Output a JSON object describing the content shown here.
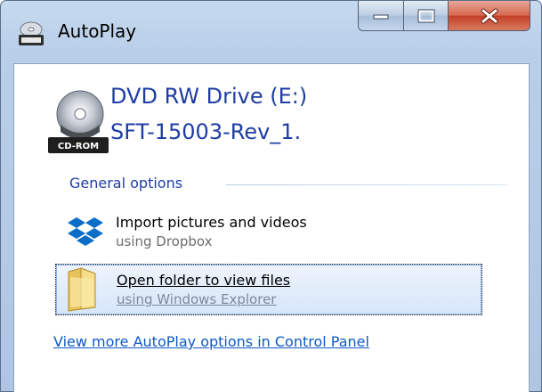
{
  "window": {
    "title": "AutoPlay"
  },
  "device": {
    "name": "DVD RW Drive (E:)",
    "disc_label": "SFT-15003-Rev_1.",
    "icon": "cd-rom-drive-icon",
    "badge_text": "CD-ROM"
  },
  "general_options": {
    "heading": "General options",
    "items": [
      {
        "title": "Import pictures and videos",
        "subtitle": "using Dropbox",
        "icon": "dropbox-icon",
        "selected": false
      },
      {
        "title": "Open folder to view files",
        "subtitle": "using Windows Explorer",
        "icon": "folder-icon",
        "selected": true
      }
    ]
  },
  "footer": {
    "control_panel_link": "View more AutoPlay options in Control Panel"
  },
  "colors": {
    "link_blue": "#1e3da4",
    "hyperlink": "#0d58c6",
    "close_red": "#c13f26"
  }
}
